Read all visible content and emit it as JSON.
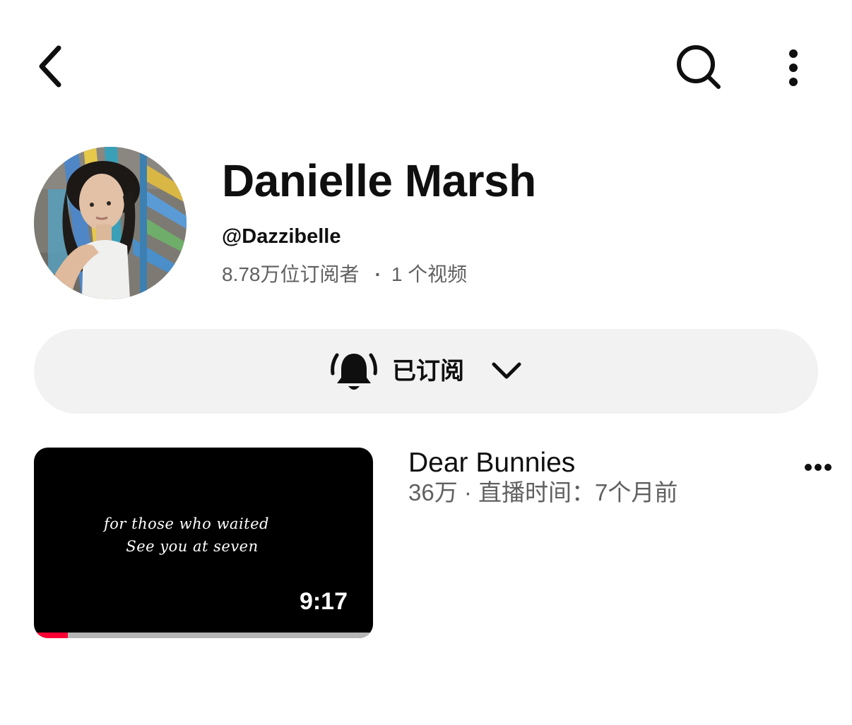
{
  "icons": {
    "back": "chevron-left",
    "search": "magnifier",
    "more": "vertical-ellipsis",
    "bell": "bell-ringing",
    "dropdown": "chevron-down",
    "video_more": "horizontal-ellipsis"
  },
  "channel": {
    "name": "Danielle Marsh",
    "handle": "@Dazzibelle",
    "subscribers": "8.78万位订阅者",
    "separator": "·",
    "video_count": "1 个视频"
  },
  "subscribe": {
    "label": "已订阅"
  },
  "video": {
    "title": "Dear Bunnies",
    "meta": "36万 · 直播时间：7个月前",
    "thumbnail_lines": [
      "for those who waited",
      "See you at seven"
    ],
    "duration": "9:17",
    "watched_fraction": 0.1
  },
  "colors": {
    "background": "#ffffff",
    "text_primary": "#0f0f0f",
    "text_secondary": "#606060",
    "pill_bg": "#f2f2f2",
    "progress_watched": "#ff0033",
    "progress_track": "#b5b5b5"
  }
}
